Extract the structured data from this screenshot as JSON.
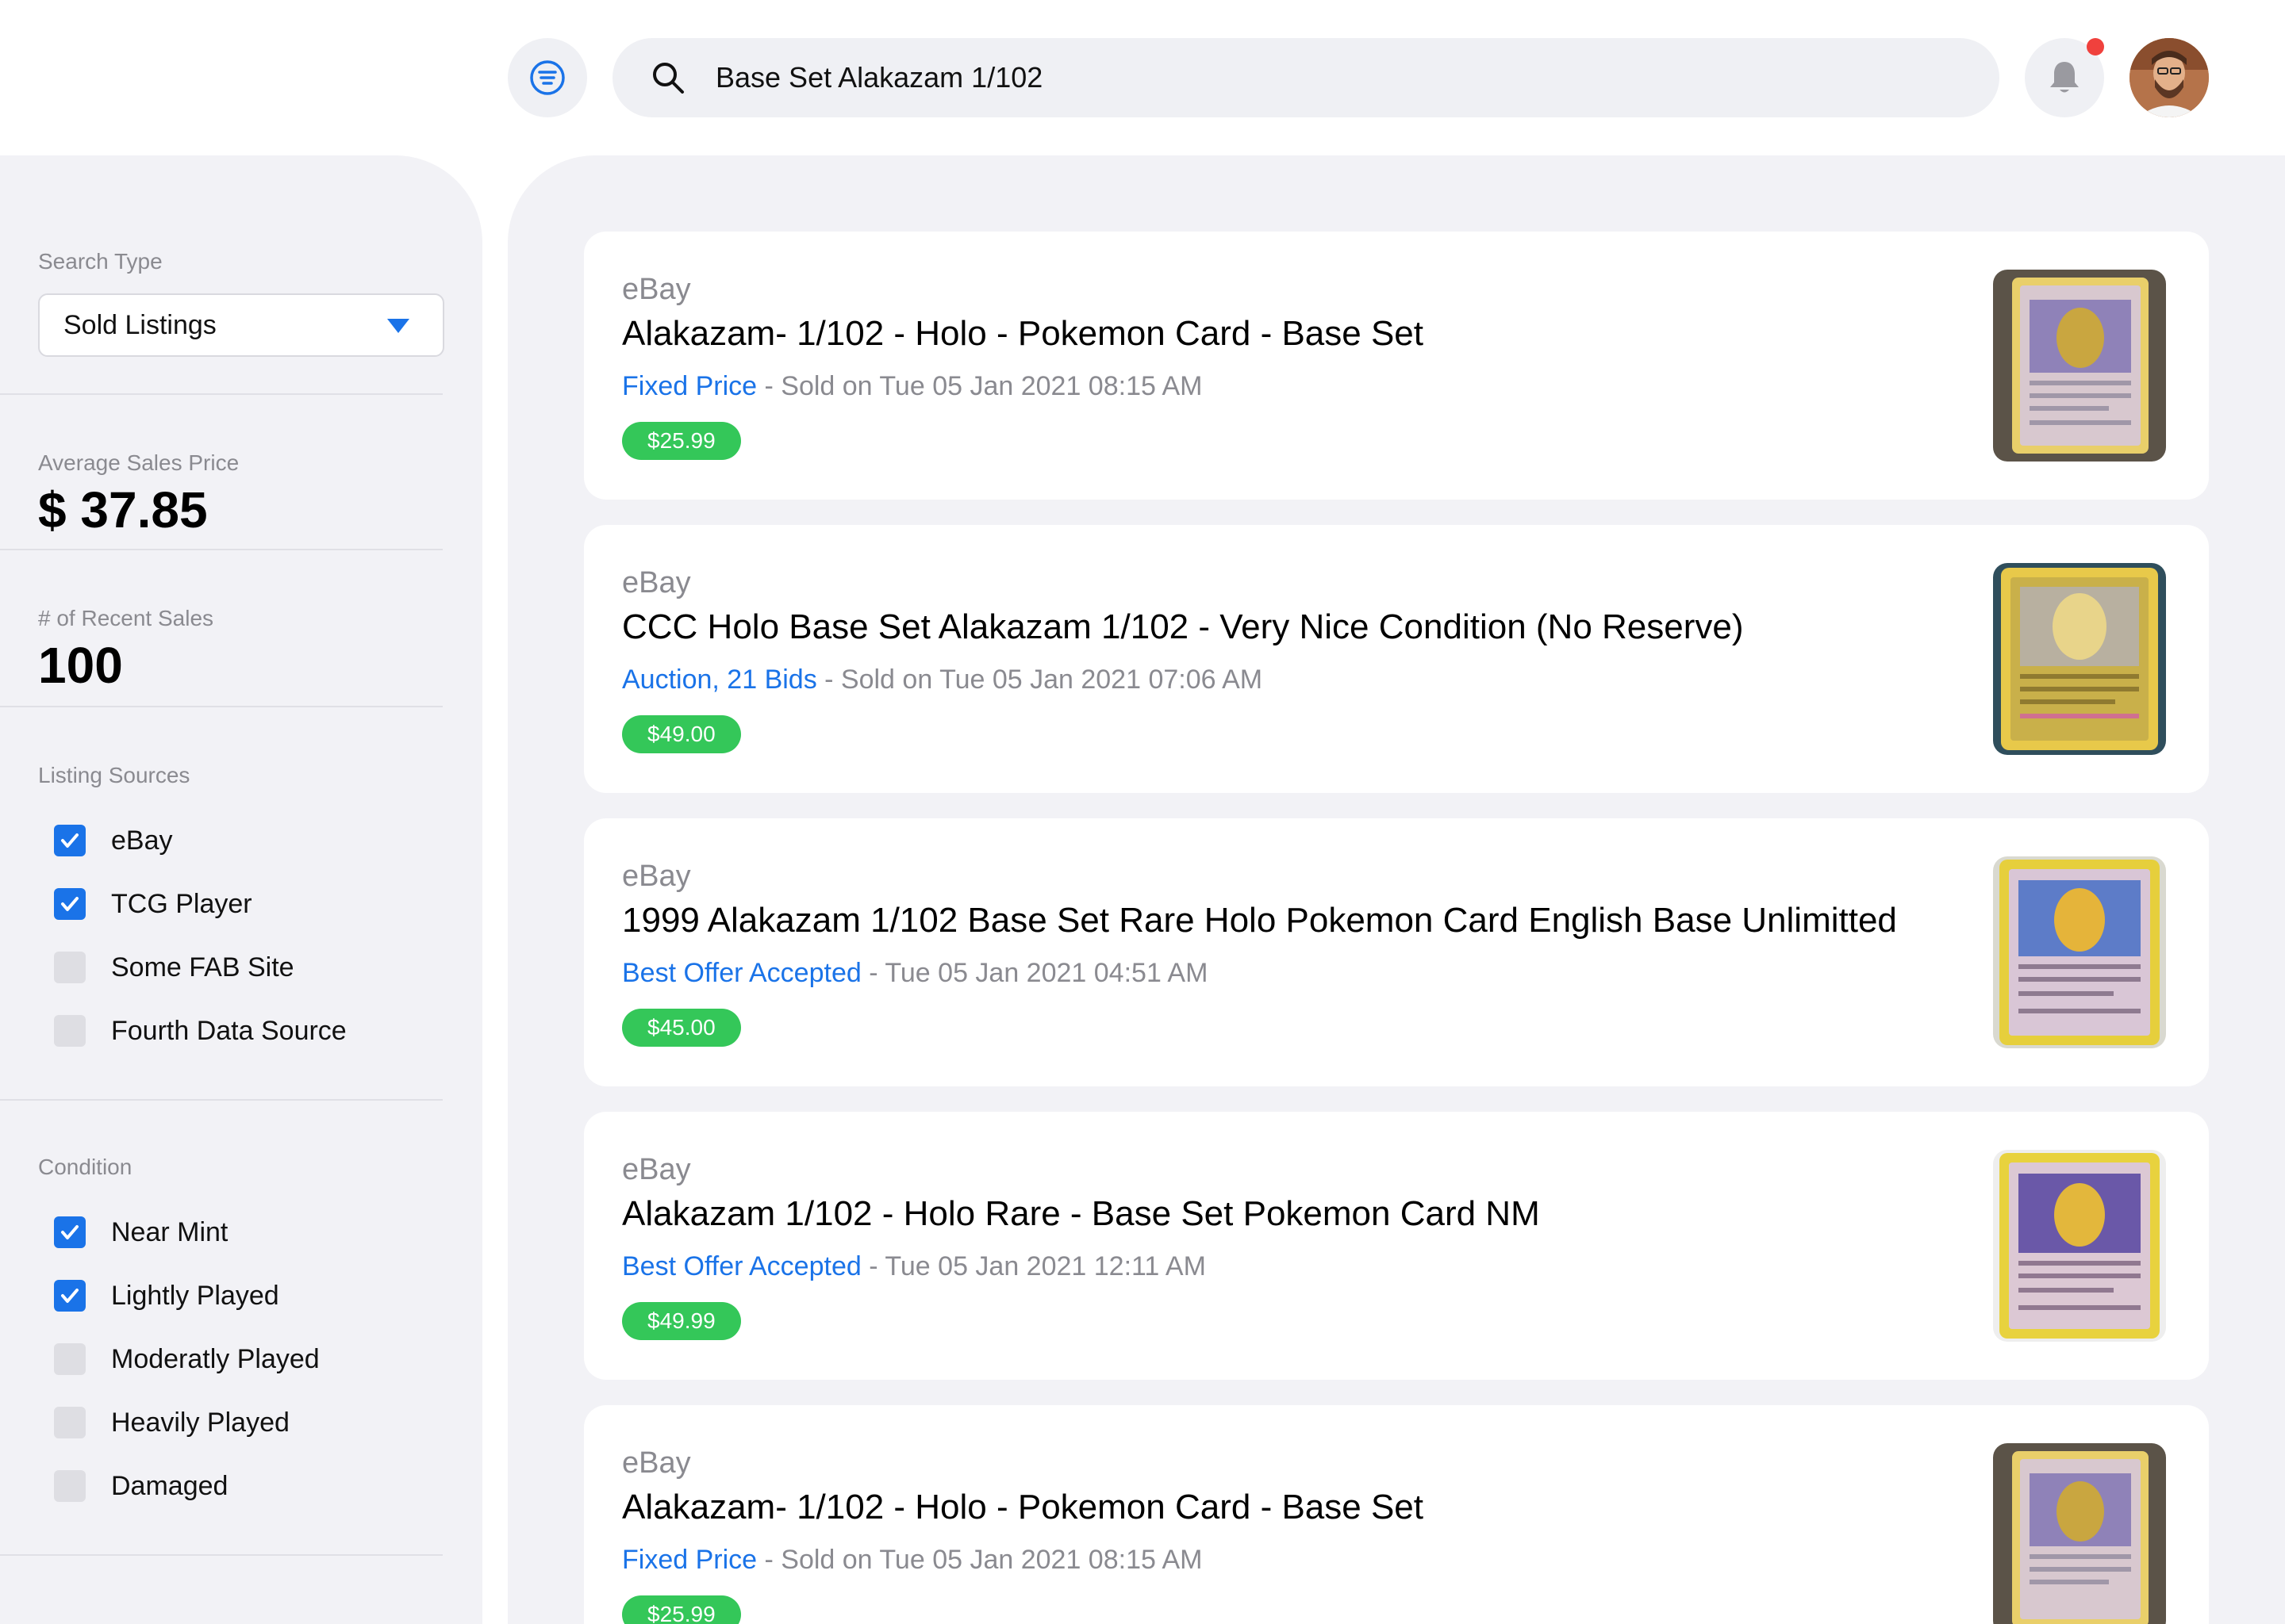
{
  "search": {
    "query": "Base Set Alakazam 1/102"
  },
  "header": {
    "avatar_icon": "avatar",
    "bell_icon": "bell-icon",
    "filter_icon": "filter-icon",
    "notification_color": "#f0413d"
  },
  "sidebar": {
    "search_type": {
      "label": "Search Type",
      "value": "Sold Listings"
    },
    "avg_price": {
      "label": "Average Sales Price",
      "value": "$ 37.85"
    },
    "recent_sales": {
      "label": "# of Recent Sales",
      "value": "100"
    },
    "sources": {
      "label": "Listing Sources",
      "items": [
        {
          "label": "eBay",
          "checked": true
        },
        {
          "label": "TCG Player",
          "checked": true
        },
        {
          "label": "Some FAB Site",
          "checked": false
        },
        {
          "label": "Fourth Data Source",
          "checked": false
        }
      ]
    },
    "condition": {
      "label": "Condition",
      "items": [
        {
          "label": "Near Mint",
          "checked": true
        },
        {
          "label": "Lightly Played",
          "checked": true
        },
        {
          "label": "Moderatly Played",
          "checked": false
        },
        {
          "label": "Heavily Played",
          "checked": false
        },
        {
          "label": "Damaged",
          "checked": false
        }
      ]
    }
  },
  "listings": [
    {
      "source": "eBay",
      "title": "Alakazam- 1/102 - Holo - Pokemon Card - Base Set",
      "type": "Fixed Price",
      "meta": " - Sold on Tue 05 Jan 2021 08:15 AM",
      "price": "$25.99"
    },
    {
      "source": "eBay",
      "title": "CCC Holo Base Set Alakazam 1/102 - Very Nice Condition (No Reserve)",
      "type": "Auction, 21 Bids",
      "meta": " - Sold on Tue 05 Jan 2021 07:06 AM",
      "price": "$49.00"
    },
    {
      "source": "eBay",
      "title": "1999 Alakazam 1/102 Base Set Rare Holo Pokemon Card English Base Unlimitted",
      "type": "Best Offer Accepted",
      "meta": " - Tue 05 Jan 2021 04:51 AM",
      "price": "$45.00"
    },
    {
      "source": "eBay",
      "title": "Alakazam 1/102 - Holo Rare - Base Set Pokemon Card NM",
      "type": "Best Offer Accepted",
      "meta": " - Tue 05 Jan 2021 12:11 AM",
      "price": "$49.99"
    },
    {
      "source": "eBay",
      "title": "Alakazam- 1/102 - Holo - Pokemon Card - Base Set",
      "type": "Fixed Price",
      "meta": " - Sold on Tue 05 Jan 2021 08:15 AM",
      "price": "$25.99"
    }
  ],
  "colors": {
    "accent": "#1a73e8",
    "price": "#34c759",
    "panel": "#f2f2f6"
  }
}
